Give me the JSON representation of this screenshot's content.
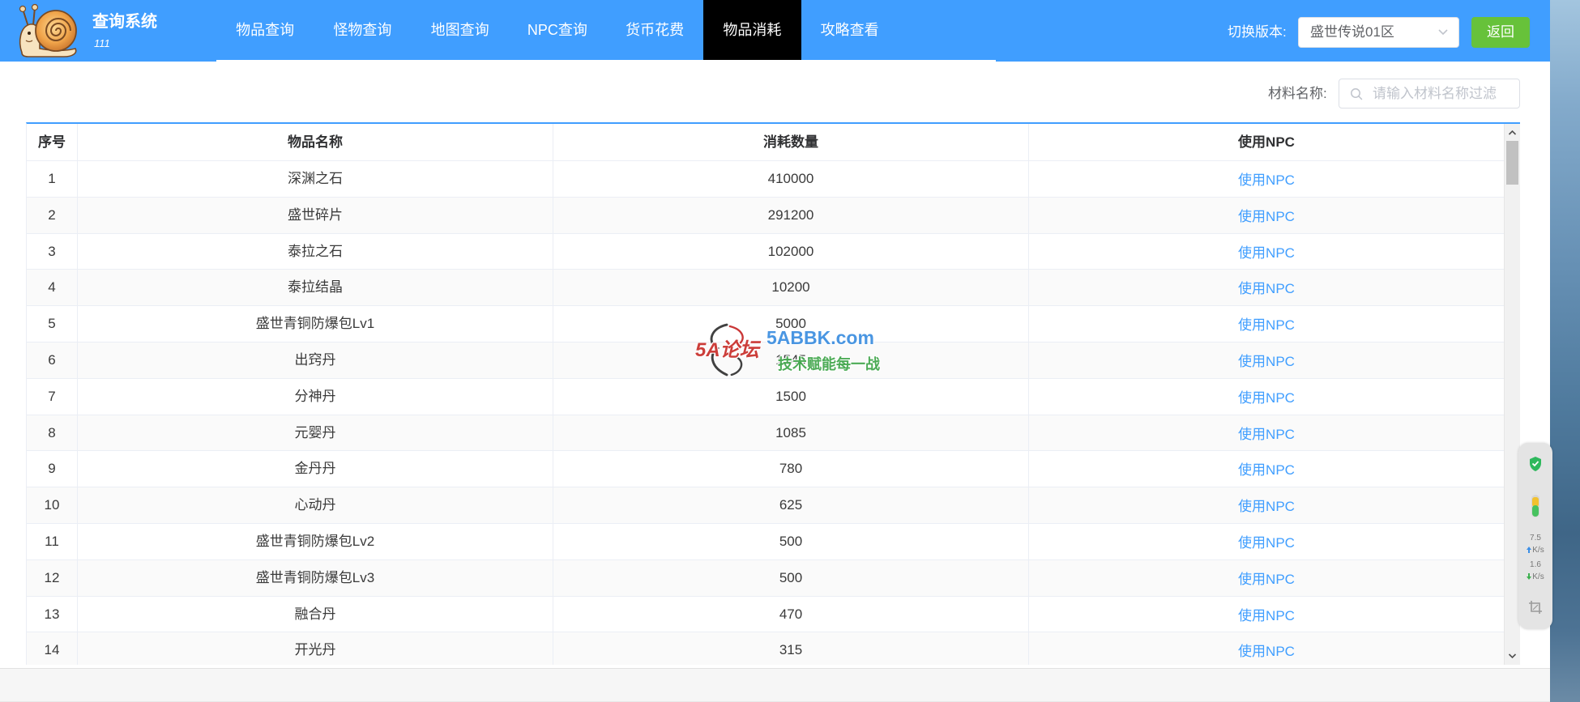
{
  "app": {
    "title": "查询系统",
    "subtitle": "111",
    "logo_icon": "snail-logo-icon"
  },
  "nav": {
    "items": [
      {
        "label": "物品查询",
        "active": false
      },
      {
        "label": "怪物查询",
        "active": false
      },
      {
        "label": "地图查询",
        "active": false
      },
      {
        "label": "NPC查询",
        "active": false
      },
      {
        "label": "货币花费",
        "active": false
      },
      {
        "label": "物品消耗",
        "active": true
      },
      {
        "label": "攻略查看",
        "active": false
      }
    ]
  },
  "version_switch": {
    "label": "切换版本:",
    "selected": "盛世传说01区",
    "icon": "chevron-down-icon"
  },
  "back_button": {
    "label": "返回"
  },
  "filter": {
    "label": "材料名称:",
    "placeholder": "请输入材料名称过滤",
    "icon": "search-icon"
  },
  "table": {
    "columns": [
      "序号",
      "物品名称",
      "消耗数量",
      "使用NPC"
    ],
    "rows": [
      {
        "index": "1",
        "name": "深渊之石",
        "count": "410000",
        "npc": "使用NPC"
      },
      {
        "index": "2",
        "name": "盛世碎片",
        "count": "291200",
        "npc": "使用NPC"
      },
      {
        "index": "3",
        "name": "泰拉之石",
        "count": "102000",
        "npc": "使用NPC"
      },
      {
        "index": "4",
        "name": "泰拉结晶",
        "count": "10200",
        "npc": "使用NPC"
      },
      {
        "index": "5",
        "name": "盛世青铜防爆包Lv1",
        "count": "5000",
        "npc": "使用NPC"
      },
      {
        "index": "6",
        "name": "出窍丹",
        "count": "1545",
        "npc": "使用NPC"
      },
      {
        "index": "7",
        "name": "分神丹",
        "count": "1500",
        "npc": "使用NPC"
      },
      {
        "index": "8",
        "name": "元婴丹",
        "count": "1085",
        "npc": "使用NPC"
      },
      {
        "index": "9",
        "name": "金丹丹",
        "count": "780",
        "npc": "使用NPC"
      },
      {
        "index": "10",
        "name": "心动丹",
        "count": "625",
        "npc": "使用NPC"
      },
      {
        "index": "11",
        "name": "盛世青铜防爆包Lv2",
        "count": "500",
        "npc": "使用NPC"
      },
      {
        "index": "12",
        "name": "盛世青铜防爆包Lv3",
        "count": "500",
        "npc": "使用NPC"
      },
      {
        "index": "13",
        "name": "融合丹",
        "count": "470",
        "npc": "使用NPC"
      },
      {
        "index": "14",
        "name": "开光丹",
        "count": "315",
        "npc": "使用NPC"
      }
    ],
    "scroll_position_percent": 0
  },
  "watermark": {
    "logo_text": "5A论坛",
    "site": "5ABBK.com",
    "slogan": "技术赋能每一战"
  },
  "desktop_widget": {
    "icons": [
      "shield-check-icon",
      "temperature-gauge-icon",
      "screenshot-crop-icon"
    ],
    "upload": {
      "value": "7.5",
      "unit": "K/s",
      "icon": "upload-arrow-icon"
    },
    "download": {
      "value": "1.6",
      "unit": "K/s",
      "icon": "download-arrow-icon"
    }
  },
  "colors": {
    "header_bg": "#409EFF",
    "active_tab_bg": "#000000",
    "back_button_bg": "#67C23A",
    "link": "#409EFF",
    "table_accent": "#409EFF",
    "row_stripe": "#FAFAFA"
  }
}
